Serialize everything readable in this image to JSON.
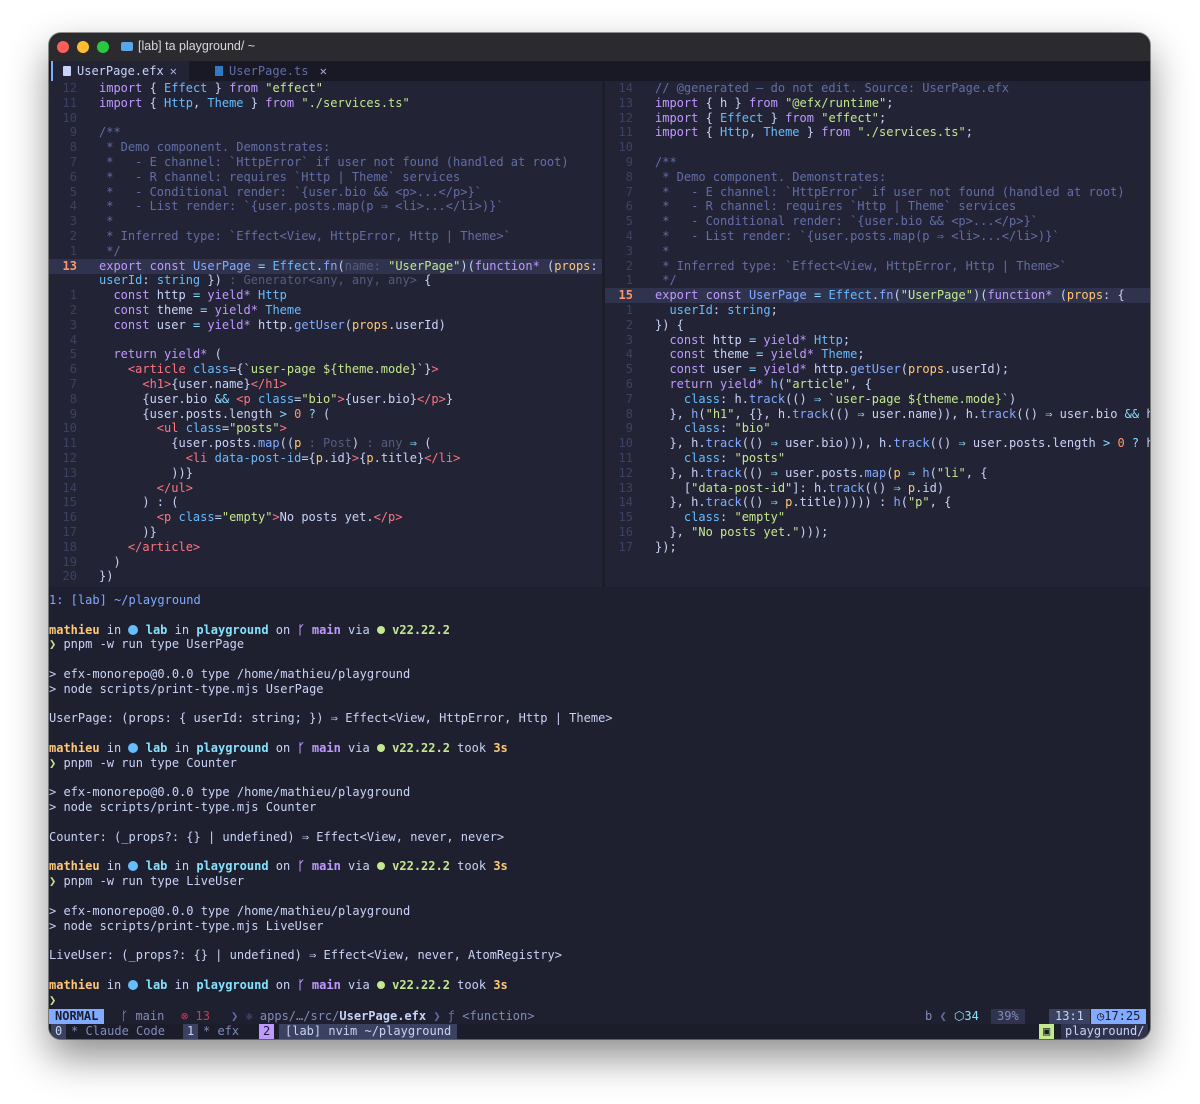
{
  "window": {
    "title": "[lab] ta playground/ ~"
  },
  "tabs": [
    {
      "label": "UserPage.efx",
      "close": "✕",
      "icon": "file-icon"
    },
    {
      "label": "UserPage.ts",
      "close": "✕",
      "icon": "typescript-icon"
    }
  ],
  "left_pane": {
    "lines": [
      {
        "ln": "12",
        "html": "<span class='k'>import</span> { <span class='t'>Effect</span> } <span class='k'>from</span> <span class='s'>\"effect\"</span>"
      },
      {
        "ln": "11",
        "html": "<span class='k'>import</span> { <span class='t'>Http</span>, <span class='t'>Theme</span> } <span class='k'>from</span> <span class='s'>\"./services.ts\"</span>"
      },
      {
        "ln": "10",
        "html": ""
      },
      {
        "ln": "9",
        "html": "<span class='c'>/**</span>"
      },
      {
        "ln": "8",
        "html": "<span class='c'> * Demo component. Demonstrates:</span>"
      },
      {
        "ln": "7",
        "html": "<span class='c'> *   - E channel: `HttpError` if user not found (handled at root)</span>"
      },
      {
        "ln": "6",
        "html": "<span class='c'> *   - R channel: requires `Http | Theme` services</span>"
      },
      {
        "ln": "5",
        "html": "<span class='c'> *   - Conditional render: `{user.bio &amp;&amp; &lt;p&gt;...&lt;/p&gt;}`</span>"
      },
      {
        "ln": "4",
        "html": "<span class='c'> *   - List render: `{user.posts.map(p ⇒ &lt;li&gt;...&lt;/li&gt;)}`</span>"
      },
      {
        "ln": "3",
        "html": "<span class='c'> *</span>"
      },
      {
        "ln": "2",
        "html": "<span class='c'> * Inferred type: `Effect&lt;View, HttpError, Http | Theme&gt;`</span>"
      },
      {
        "ln": "1",
        "html": "<span class='c'> */</span>"
      },
      {
        "ln": "13",
        "cur": true,
        "html": "<span class='k'>export</span> <span class='k'>const</span> <span class='f'>UserPage</span> <span class='o'>=</span> <span class='t'>Effect</span>.<span class='f'>fn</span>(<span class='hint'>name:</span> <span class='s'>\"UserPage\"</span>)(<span class='k'>function*</span> (<span class='p'>props</span>: {"
      },
      {
        "ln": "",
        "html": "<span class='t'>userId</span>: <span class='t'>string</span> }) <span class='hint'>: Generator&lt;any, any, any&gt;</span> {"
      },
      {
        "ln": "1",
        "html": "  <span class='k'>const</span> http <span class='o'>=</span> <span class='k'>yield*</span> <span class='t'>Http</span>"
      },
      {
        "ln": "2",
        "html": "  <span class='k'>const</span> theme <span class='o'>=</span> <span class='k'>yield*</span> <span class='t'>Theme</span>"
      },
      {
        "ln": "3",
        "html": "  <span class='k'>const</span> user <span class='o'>=</span> <span class='k'>yield*</span> http.<span class='f'>getUser</span>(<span class='p'>props</span>.userId)"
      },
      {
        "ln": "4",
        "html": ""
      },
      {
        "ln": "5",
        "html": "  <span class='k'>return</span> <span class='k'>yield*</span> ("
      },
      {
        "ln": "6",
        "html": "    <span class='r'>&lt;article</span> <span class='t'>class</span>={`<span class='s'>user-page ${theme.mode}</span>`}<span class='r'>&gt;</span>"
      },
      {
        "ln": "7",
        "html": "      <span class='r'>&lt;h1&gt;</span>{user.name}<span class='r'>&lt;/h1&gt;</span>"
      },
      {
        "ln": "8",
        "html": "      {user.bio <span class='o'>&amp;&amp;</span> <span class='r'>&lt;p</span> <span class='t'>class</span>=<span class='s'>\"bio\"</span><span class='r'>&gt;</span>{user.bio}<span class='r'>&lt;/p&gt;</span>}"
      },
      {
        "ln": "9",
        "html": "      {user.posts.length <span class='o'>&gt;</span> <span class='n'>0</span> <span class='o'>?</span> ("
      },
      {
        "ln": "10",
        "html": "        <span class='r'>&lt;ul</span> <span class='t'>class</span>=<span class='s'>\"posts\"</span><span class='r'>&gt;</span>"
      },
      {
        "ln": "11",
        "html": "          {user.posts.<span class='f'>map</span>((<span class='p'>p</span> <span class='hint'>: Post</span>) <span class='hint'>: any</span> <span class='o'>⇒</span> ("
      },
      {
        "ln": "12",
        "html": "            <span class='r'>&lt;li</span> <span class='t'>data-post-id</span>={<span class='p'>p</span>.id}<span class='r'>&gt;</span>{<span class='p'>p</span>.title}<span class='r'>&lt;/li&gt;</span>"
      },
      {
        "ln": "13",
        "html": "          ))}"
      },
      {
        "ln": "14",
        "html": "        <span class='r'>&lt;/ul&gt;</span>"
      },
      {
        "ln": "15",
        "html": "      ) : ("
      },
      {
        "ln": "16",
        "html": "        <span class='r'>&lt;p</span> <span class='t'>class</span>=<span class='s'>\"empty\"</span><span class='r'>&gt;</span>No posts yet.<span class='r'>&lt;/p&gt;</span>"
      },
      {
        "ln": "17",
        "html": "      )}"
      },
      {
        "ln": "18",
        "html": "    <span class='r'>&lt;/article&gt;</span>"
      },
      {
        "ln": "19",
        "html": "  )"
      },
      {
        "ln": "20",
        "html": "})"
      }
    ]
  },
  "right_pane": {
    "lines": [
      {
        "ln": "14",
        "html": "<span class='c'>// @generated — do not edit. Source: UserPage.efx</span>"
      },
      {
        "ln": "13",
        "html": "<span class='k'>import</span> { h } <span class='k'>from</span> <span class='s'>\"@efx/runtime\"</span>;"
      },
      {
        "ln": "12",
        "html": "<span class='k'>import</span> { <span class='t'>Effect</span> } <span class='k'>from</span> <span class='s'>\"effect\"</span>;"
      },
      {
        "ln": "11",
        "html": "<span class='k'>import</span> { <span class='t'>Http</span>, <span class='t'>Theme</span> } <span class='k'>from</span> <span class='s'>\"./services.ts\"</span>;"
      },
      {
        "ln": "10",
        "html": ""
      },
      {
        "ln": "9",
        "html": "<span class='c'>/**</span>"
      },
      {
        "ln": "8",
        "html": "<span class='c'> * Demo component. Demonstrates:</span>"
      },
      {
        "ln": "7",
        "html": "<span class='c'> *   - E channel: `HttpError` if user not found (handled at root)</span>"
      },
      {
        "ln": "6",
        "html": "<span class='c'> *   - R channel: requires `Http | Theme` services</span>"
      },
      {
        "ln": "5",
        "html": "<span class='c'> *   - Conditional render: `{user.bio &amp;&amp; &lt;p&gt;...&lt;/p&gt;}`</span>"
      },
      {
        "ln": "4",
        "html": "<span class='c'> *   - List render: `{user.posts.map(p ⇒ &lt;li&gt;...&lt;/li&gt;)}`</span>"
      },
      {
        "ln": "3",
        "html": "<span class='c'> *</span>"
      },
      {
        "ln": "2",
        "html": "<span class='c'> * Inferred type: `Effect&lt;View, HttpError, Http | Theme&gt;`</span>"
      },
      {
        "ln": "1",
        "html": "<span class='c'> */</span>"
      },
      {
        "ln": "15",
        "cur": true,
        "html": "<span class='k'>export</span> <span class='k'>const</span> <span class='f'>UserPage</span> <span class='o'>=</span> <span class='t'>Effect</span>.<span class='f'>fn</span>(<span class='s'>\"UserPage\"</span>)(<span class='k'>function*</span> (<span class='p'>props</span>: {"
      },
      {
        "ln": "1",
        "html": "  <span class='t'>userId</span>: <span class='t'>string</span>;"
      },
      {
        "ln": "2",
        "html": "}) {"
      },
      {
        "ln": "3",
        "html": "  <span class='k'>const</span> http <span class='o'>=</span> <span class='k'>yield*</span> <span class='t'>Http</span>;"
      },
      {
        "ln": "4",
        "html": "  <span class='k'>const</span> theme <span class='o'>=</span> <span class='k'>yield*</span> <span class='t'>Theme</span>;"
      },
      {
        "ln": "5",
        "html": "  <span class='k'>const</span> user <span class='o'>=</span> <span class='k'>yield*</span> http.<span class='f'>getUser</span>(<span class='p'>props</span>.userId);"
      },
      {
        "ln": "6",
        "html": "  <span class='k'>return</span> <span class='k'>yield*</span> <span class='f'>h</span>(<span class='s'>\"article\"</span>, {"
      },
      {
        "ln": "7",
        "html": "    <span class='t'>class</span>: h.<span class='f'>track</span>(() <span class='o'>⇒</span> `<span class='s'>user-page ${theme.mode}</span>`)"
      },
      {
        "ln": "8",
        "html": "  }, <span class='f'>h</span>(<span class='s'>\"h1\"</span>, {}, h.<span class='f'>track</span>(() <span class='o'>⇒</span> user.name)), h.<span class='f'>track</span>(() <span class='o'>⇒</span> user.bio <span class='o'>&amp;&amp;</span> h"
      },
      {
        "ln": "9",
        "html": "    <span class='t'>class</span>: <span class='s'>\"bio\"</span>"
      },
      {
        "ln": "10",
        "html": "  }, h.<span class='f'>track</span>(() <span class='o'>⇒</span> user.bio))), h.<span class='f'>track</span>(() <span class='o'>⇒</span> user.posts.length <span class='o'>&gt;</span> <span class='n'>0</span> <span class='o'>?</span> h"
      },
      {
        "ln": "11",
        "html": "    <span class='t'>class</span>: <span class='s'>\"posts\"</span>"
      },
      {
        "ln": "12",
        "html": "  }, h.<span class='f'>track</span>(() <span class='o'>⇒</span> user.posts.<span class='f'>map</span>(<span class='p'>p</span> <span class='o'>⇒</span> <span class='f'>h</span>(<span class='s'>\"li\"</span>, {"
      },
      {
        "ln": "13",
        "html": "    [<span class='s'>\"data-post-id\"</span>]: h.<span class='f'>track</span>(() <span class='o'>⇒</span> <span class='p'>p</span>.id)"
      },
      {
        "ln": "14",
        "html": "  }, h.<span class='f'>track</span>(() <span class='o'>⇒</span> <span class='p'>p</span>.title))))) : <span class='f'>h</span>(<span class='s'>\"p\"</span>, {"
      },
      {
        "ln": "15",
        "html": "    <span class='t'>class</span>: <span class='s'>\"empty\"</span>"
      },
      {
        "ln": "16",
        "html": "  }, <span class='s'>\"No posts yet.\"</span>)));"
      },
      {
        "ln": "17",
        "html": "});"
      }
    ]
  },
  "terminal": {
    "header": "1: [lab] ~/playground",
    "prompt": {
      "user": "mathieu",
      "host": "lab",
      "dir": "playground",
      "branch": "main",
      "node": "v22.22.2"
    },
    "blocks": [
      {
        "cmd": "pnpm -w run type UserPage",
        "took": "",
        "out": [
          "> efx-monorepo@0.0.0 type /home/mathieu/playground",
          "> node scripts/print-type.mjs UserPage",
          "",
          "UserPage: (props: { userId: string; }) ⇒ Effect<View, HttpError, Http | Theme>"
        ]
      },
      {
        "cmd": "pnpm -w run type Counter",
        "took": "3s",
        "out": [
          "> efx-monorepo@0.0.0 type /home/mathieu/playground",
          "> node scripts/print-type.mjs Counter",
          "",
          "Counter: (_props?: {} | undefined) ⇒ Effect<View, never, never>"
        ]
      },
      {
        "cmd": "pnpm -w run type LiveUser",
        "took": "3s",
        "out": [
          "> efx-monorepo@0.0.0 type /home/mathieu/playground",
          "> node scripts/print-type.mjs LiveUser",
          "",
          "LiveUser: (_props?: {} | undefined) ⇒ Effect<View, never, AtomRegistry>"
        ]
      }
    ],
    "final_took": "3s"
  },
  "statusline": {
    "mode": "NORMAL",
    "branch": "main",
    "errors": "13",
    "path": "apps/…/src/",
    "file": "UserPage.efx",
    "symbol": "<function>",
    "right": {
      "b": "b",
      "lsp": "34",
      "percent": "39%",
      "pos": "13:1",
      "time": "17:25"
    }
  },
  "tmux": {
    "windows": [
      {
        "index": "0",
        "label": "Claude Code"
      },
      {
        "index": "1",
        "label": "efx"
      },
      {
        "index": "2",
        "label": "[lab] nvim ~/playground"
      }
    ],
    "session": "playground/"
  },
  "colors": {
    "bg": "#222436",
    "keyword": "#c099ff",
    "string": "#c3e88d",
    "comment": "#636da6",
    "accent": "#82aaff"
  }
}
